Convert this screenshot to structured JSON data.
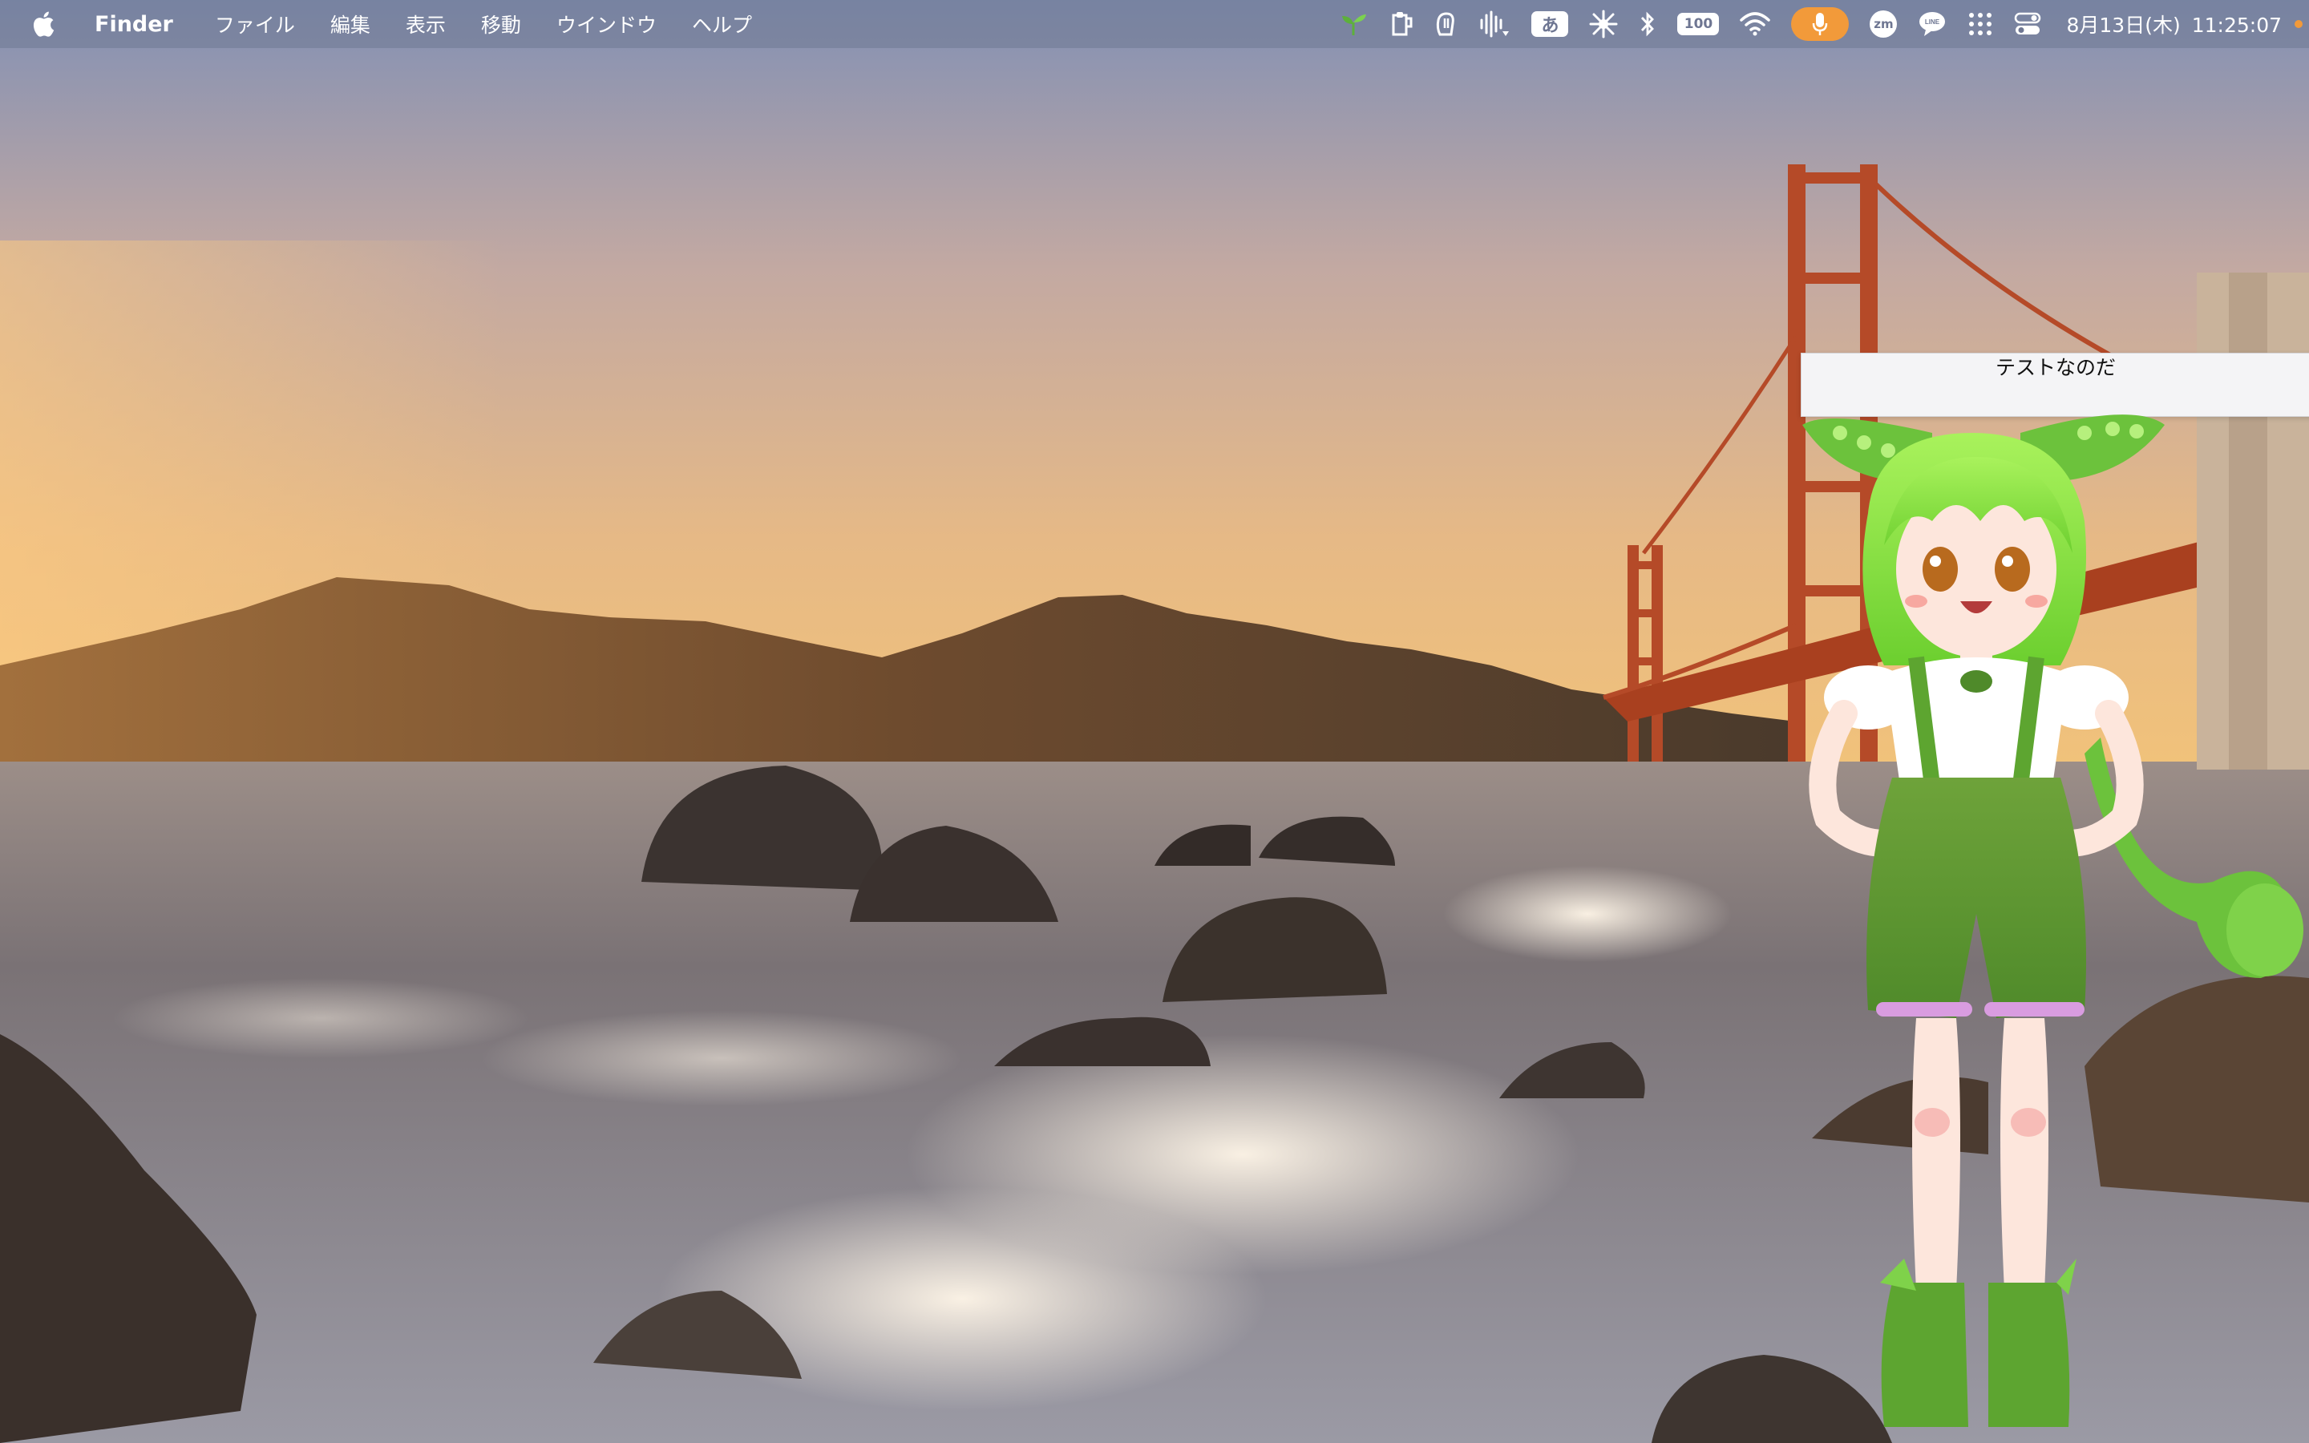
{
  "menubar": {
    "app_name": "Finder",
    "menus": [
      "ファイル",
      "編集",
      "表示",
      "移動",
      "ウインドウ",
      "ヘルプ"
    ],
    "tray_icons": [
      "sprout-icon",
      "clipboard-icon",
      "hand-icon",
      "audio-waveform-icon",
      "input-method-icon",
      "brightness-icon",
      "bluetooth-icon",
      "battery-icon",
      "wifi-icon",
      "microphone-icon",
      "zoom-icon",
      "line-icon",
      "app-grid-icon",
      "control-center-icon"
    ],
    "input_method_label": "あ",
    "battery_label": "100",
    "zoom_label": "zm",
    "line_label": "LINE",
    "date": "8月13日(木)",
    "time": "11:25:07",
    "accent_color": "#f29a3a"
  },
  "bubble": {
    "text": "テストなのだ"
  },
  "desktop": {
    "wallpaper": "golden-gate-bridge-sunset-wallpaper"
  },
  "character": {
    "name_icon": "green-haired-mascot-character"
  }
}
